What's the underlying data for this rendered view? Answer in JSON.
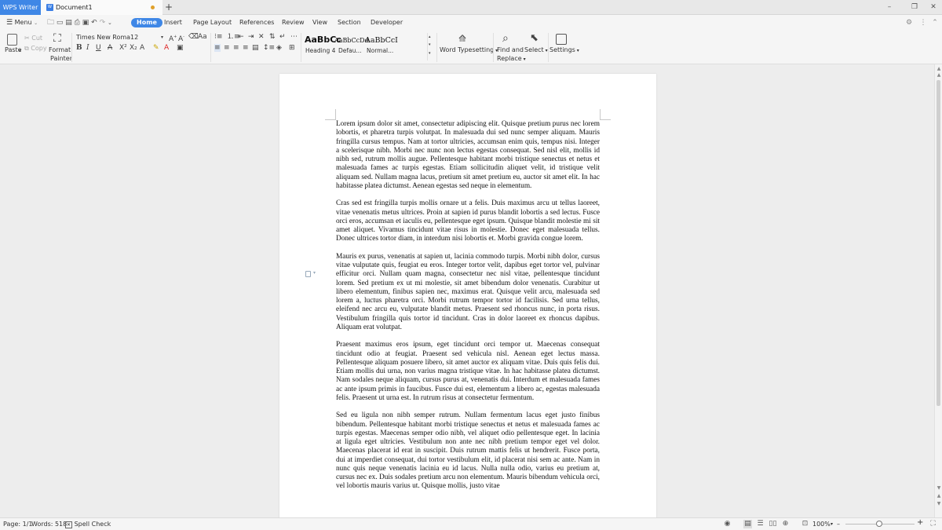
{
  "titlebar": {
    "app_name": "WPS Writer",
    "doc_tab_icon": "W",
    "doc_name": "Document1",
    "new_tab": "+",
    "controls": {
      "minimize": "–",
      "restore": "❐",
      "close": "✕"
    }
  },
  "menubar": {
    "menu_label": "Menu",
    "tabs": [
      "Home",
      "Insert",
      "Page Layout",
      "References",
      "Review",
      "View",
      "Section",
      "Developer"
    ]
  },
  "ribbon": {
    "paste": "Paste",
    "cut": "Cut",
    "copy": "Copy",
    "format_painter_1": "Format",
    "format_painter_2": "Painter",
    "font_name": "Times New Roma",
    "font_size": "12",
    "styles": [
      {
        "preview": "AaBbCc",
        "label": "Heading 4"
      },
      {
        "preview": "AaBbCcDd",
        "label": "Defau..."
      },
      {
        "preview": "AaBbCcI",
        "label": "Normal..."
      }
    ],
    "word_typesetting": "Word Typesetting",
    "find_replace_1": "Find and",
    "find_replace_2": "Replace",
    "select": "Select",
    "settings": "Settings"
  },
  "document": {
    "paragraphs": [
      "Lorem ipsum dolor sit amet, consectetur adipiscing elit. Quisque pretium purus nec lorem lobortis, et pharetra turpis volutpat. In malesuada dui sed nunc semper aliquam. Mauris fringilla cursus tempus. Nam at tortor ultricies, accumsan enim quis, tempus nisi. Integer a scelerisque nibh. Morbi nec nunc non lectus egestas consequat. Sed nisl elit, mollis id nibh sed, rutrum mollis augue. Pellentesque habitant morbi tristique senectus et netus et malesuada fames ac turpis egestas. Etiam sollicitudin aliquet velit, id tristique velit aliquam sed. Nullam magna lacus, pretium sit amet pretium eu, auctor sit amet elit. In hac habitasse platea dictumst. Aenean egestas sed neque in elementum.",
      "Cras sed est fringilla turpis mollis ornare ut a felis. Duis maximus arcu ut tellus laoreet, vitae venenatis metus ultrices. Proin at sapien id purus blandit lobortis a sed lectus. Fusce orci eros, accumsan et iaculis eu, pellentesque eget ipsum. Quisque blandit molestie mi sit amet aliquet. Vivamus tincidunt vitae risus in molestie. Donec eget malesuada tellus. Donec ultrices tortor diam, in interdum nisi lobortis et. Morbi gravida congue lorem.",
      "Mauris ex purus, venenatis at sapien ut, lacinia commodo turpis. Morbi nibh dolor, cursus vitae vulputate quis, feugiat eu eros. Integer tortor velit, dapibus eget tortor vel, pulvinar efficitur orci. Nullam quam magna, consectetur nec nisl vitae, pellentesque tincidunt lorem. Sed pretium ex ut mi molestie, sit amet bibendum dolor venenatis. Curabitur ut libero elementum, finibus sapien nec, maximus erat. Quisque velit arcu, malesuada sed lorem a, luctus pharetra orci. Morbi rutrum tempor tortor id facilisis. Sed urna tellus, eleifend nec arcu eu, vulputate blandit metus. Praesent sed rhoncus nunc, in porta risus. Vestibulum fringilla quis tortor id tincidunt. Cras in dolor laoreet ex rhoncus dapibus. Aliquam erat volutpat.",
      "Praesent maximus eros ipsum, eget tincidunt orci tempor ut. Maecenas consequat tincidunt odio at feugiat. Praesent sed vehicula nisl. Aenean eget lectus massa. Pellentesque aliquam posuere libero, sit amet auctor ex aliquam vitae. Duis quis felis dui. Etiam mollis dui urna, non varius magna tristique vitae. In hac habitasse platea dictumst. Nam sodales neque aliquam, cursus purus at, venenatis dui. Interdum et malesuada fames ac ante ipsum primis in faucibus. Fusce dui est, elementum a libero ac, egestas malesuada felis. Praesent ut urna est. In rutrum risus at consectetur fermentum.",
      "Sed eu ligula non nibh semper rutrum. Nullam fermentum lacus eget justo finibus bibendum. Pellentesque habitant morbi tristique senectus et netus et malesuada fames ac turpis egestas. Maecenas semper odio nibh, vel aliquet odio pellentesque eget. In lacinia at ligula eget ultricies. Vestibulum non ante nec nibh pretium tempor eget vel dolor. Maecenas placerat id erat in suscipit. Duis rutrum mattis felis ut hendrerit. Fusce porta, dui at imperdiet consequat, dui tortor vestibulum elit, id placerat nisi sem ac ante. Nam in nunc quis neque venenatis lacinia eu id lacus. Nulla nulla odio, varius eu pretium at, cursus nec ex. Duis sodales pretium arcu non elementum. Mauris bibendum vehicula orci, vel lobortis mauris varius ut. Quisque mollis, justo vitae"
    ]
  },
  "statusbar": {
    "page": "Page: 1/1",
    "words": "Words: 518",
    "spell_check": "Spell Check",
    "zoom": "100%",
    "zoom_minus": "–",
    "zoom_plus": "+"
  },
  "colors": {
    "accent": "#3f87e6",
    "modified_dot": "#e0a02a"
  }
}
